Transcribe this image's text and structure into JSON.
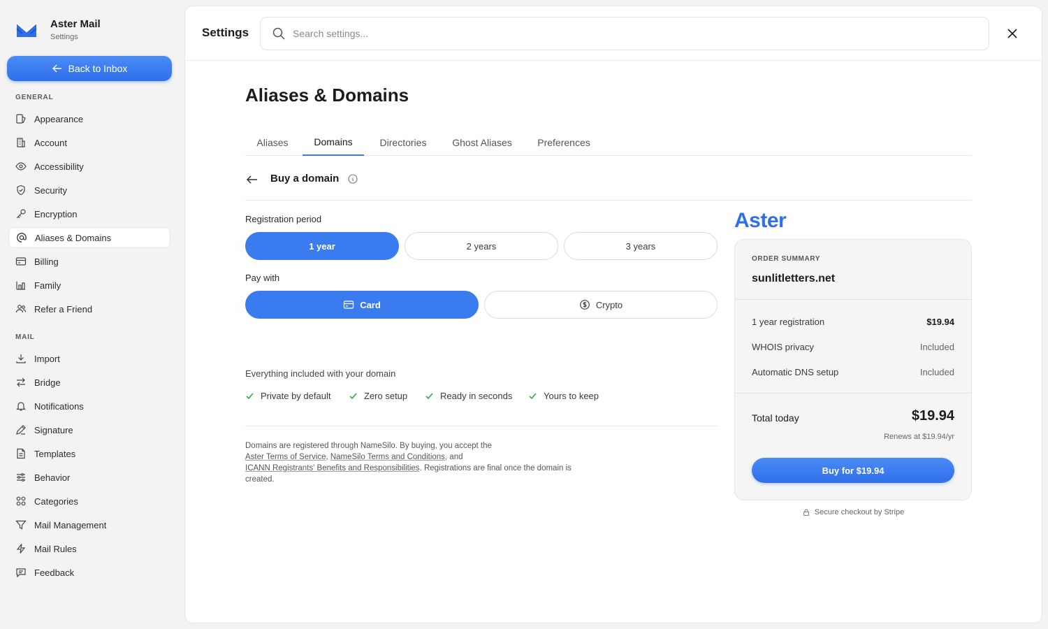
{
  "brand": {
    "name": "Aster Mail",
    "subtitle": "Settings"
  },
  "sidebar": {
    "back_label": "Back to Inbox",
    "general_label": "GENERAL",
    "general_items": [
      {
        "label": "Appearance",
        "icon": "appearance-icon"
      },
      {
        "label": "Account",
        "icon": "building-icon"
      },
      {
        "label": "Accessibility",
        "icon": "eye-icon"
      },
      {
        "label": "Security",
        "icon": "shield-icon"
      },
      {
        "label": "Encryption",
        "icon": "key-icon"
      },
      {
        "label": "Aliases & Domains",
        "icon": "at-icon",
        "active": true
      },
      {
        "label": "Billing",
        "icon": "card-icon"
      },
      {
        "label": "Family",
        "icon": "family-icon"
      },
      {
        "label": "Refer a Friend",
        "icon": "users-icon"
      }
    ],
    "mail_label": "MAIL",
    "mail_items": [
      {
        "label": "Import",
        "icon": "download-icon"
      },
      {
        "label": "Bridge",
        "icon": "arrows-icon"
      },
      {
        "label": "Notifications",
        "icon": "bell-icon"
      },
      {
        "label": "Signature",
        "icon": "pen-icon"
      },
      {
        "label": "Templates",
        "icon": "document-icon"
      },
      {
        "label": "Behavior",
        "icon": "sliders-icon"
      },
      {
        "label": "Categories",
        "icon": "grid-icon"
      },
      {
        "label": "Mail Management",
        "icon": "filter-icon"
      },
      {
        "label": "Mail Rules",
        "icon": "bolt-icon"
      },
      {
        "label": "Feedback",
        "icon": "message-icon"
      }
    ]
  },
  "topbar": {
    "title": "Settings",
    "search_placeholder": "Search settings..."
  },
  "page": {
    "title": "Aliases & Domains",
    "tabs": [
      {
        "label": "Aliases"
      },
      {
        "label": "Domains",
        "active": true
      },
      {
        "label": "Directories"
      },
      {
        "label": "Ghost Aliases"
      },
      {
        "label": "Preferences"
      }
    ],
    "subhead": "Buy a domain",
    "registration_label": "Registration period",
    "periods": [
      {
        "label": "1 year",
        "active": true
      },
      {
        "label": "2 years"
      },
      {
        "label": "3 years"
      }
    ],
    "pay_label": "Pay with",
    "pay_options": [
      {
        "label": "Card",
        "active": true,
        "icon": "card-icon"
      },
      {
        "label": "Crypto",
        "icon": "coin-icon"
      }
    ],
    "included_title": "Everything included with your domain",
    "features": [
      "Private by default",
      "Zero setup",
      "Ready in seconds",
      "Yours to keep"
    ],
    "legal": {
      "p1": "Domains are registered through NameSilo. By buying, you accept the",
      "l1": "Aster Terms of Service",
      "sep1": ", ",
      "l2": "NameSilo Terms and Conditions",
      "sep2": ", and",
      "l3": "ICANN Registrants' Benefits and Responsibilities",
      "p2": ". Registrations are final once the domain is created."
    }
  },
  "summary": {
    "logo_text": "Aster",
    "label": "ORDER SUMMARY",
    "domain": "sunlitletters.net",
    "rows": [
      {
        "label": "1 year registration",
        "value": "$19.94"
      },
      {
        "label": "WHOIS privacy",
        "value": "Included"
      },
      {
        "label": "Automatic DNS setup",
        "value": "Included"
      }
    ],
    "total_label": "Total today",
    "total_value": "$19.94",
    "renews": "Renews at $19.94/yr",
    "buy_label": "Buy for $19.94",
    "secure": "Secure checkout by Stripe"
  },
  "colors": {
    "accent": "#3b7bf0",
    "check": "#2fa84f"
  }
}
